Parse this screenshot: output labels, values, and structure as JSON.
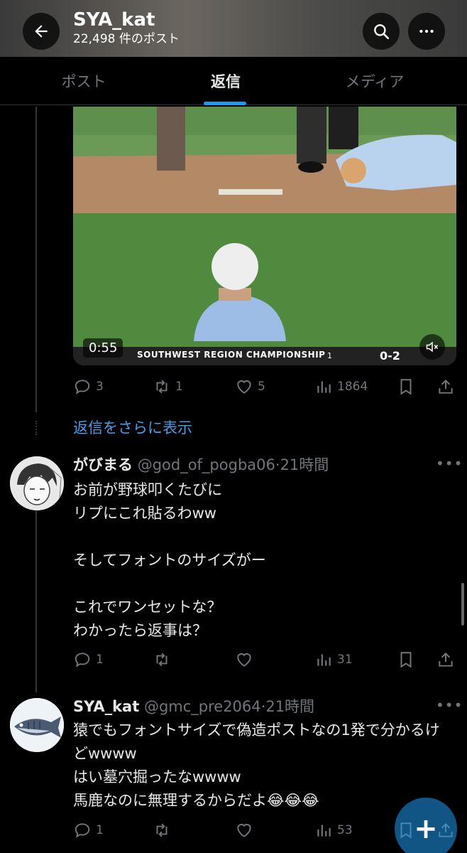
{
  "header": {
    "title": "SYA_kat",
    "subtitle": "22,498 件のポスト"
  },
  "tabs": [
    {
      "label": "ポスト",
      "active": false
    },
    {
      "label": "返信",
      "active": true
    },
    {
      "label": "メディア",
      "active": false
    }
  ],
  "video": {
    "time": "0:55",
    "scoreboard_text": "SOUTHWEST REGION CHAMPIONSHIP",
    "score": "0-2",
    "inning": "1"
  },
  "video_post_actions": {
    "replies": "3",
    "reposts": "1",
    "likes": "5",
    "views": "1864"
  },
  "show_more_replies": "返信をさらに表示",
  "replies": [
    {
      "name": "がびまる",
      "handle": "@god_of_pogba06",
      "time": "21時間",
      "body": "お前が野球叩くたびに\nリプにこれ貼るわww\n\nそしてフォントのサイズがー\n\nこれでワンセットな？\nわかったら返事は？",
      "actions": {
        "replies": "1",
        "reposts": "",
        "likes": "",
        "views": "31"
      }
    },
    {
      "name": "SYA_kat",
      "handle": "@gmc_pre2064",
      "time": "21時間",
      "body": "猿でもフォントサイズで偽造ポストなの1発で分かるけどwwww\nはい墓穴掘ったなwwww\n馬鹿なのに無理するからだよ😂😂😂",
      "actions": {
        "replies": "1",
        "reposts": "",
        "likes": "",
        "views": "53"
      }
    }
  ],
  "colors": {
    "accent": "#1d9bf0",
    "muted": "#71767b",
    "text": "#e7e9ea",
    "background": "#000000"
  }
}
